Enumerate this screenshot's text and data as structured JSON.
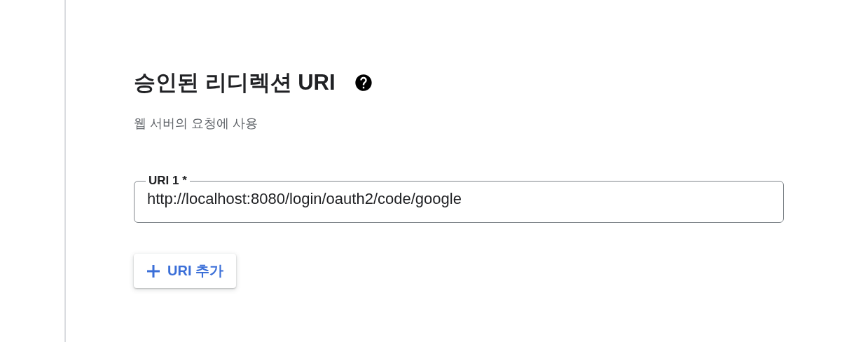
{
  "section": {
    "title": "승인된 리디렉션 URI",
    "description": "웹 서버의 요청에 사용"
  },
  "uris": [
    {
      "label": "URI 1 *",
      "value": "http://localhost:8080/login/oauth2/code/google"
    }
  ],
  "add_button": {
    "label": "URI 추가"
  }
}
